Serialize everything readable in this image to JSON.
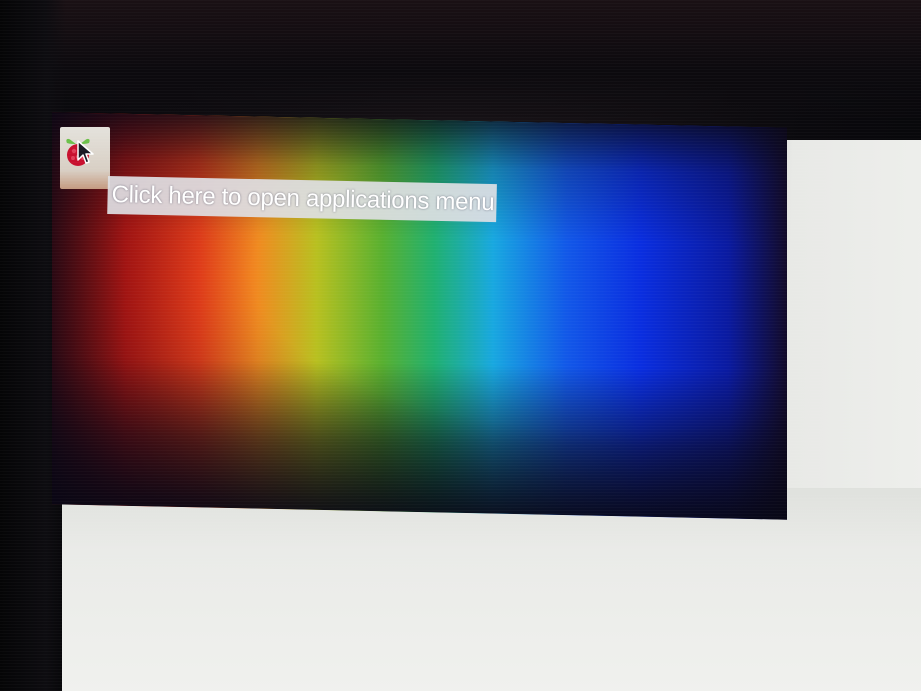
{
  "panel": {
    "menu_button_icon": "raspberry-pi-logo-icon",
    "tooltip_text": "Click here to open applications menu"
  },
  "desktop": {
    "wallpaper": "rainbow-gradient"
  },
  "colors": {
    "tooltip_bg": "#dfe0e4",
    "tooltip_text": "#ffffff",
    "berry_red": "#c8102e",
    "leaf_green": "#6cc04a"
  }
}
